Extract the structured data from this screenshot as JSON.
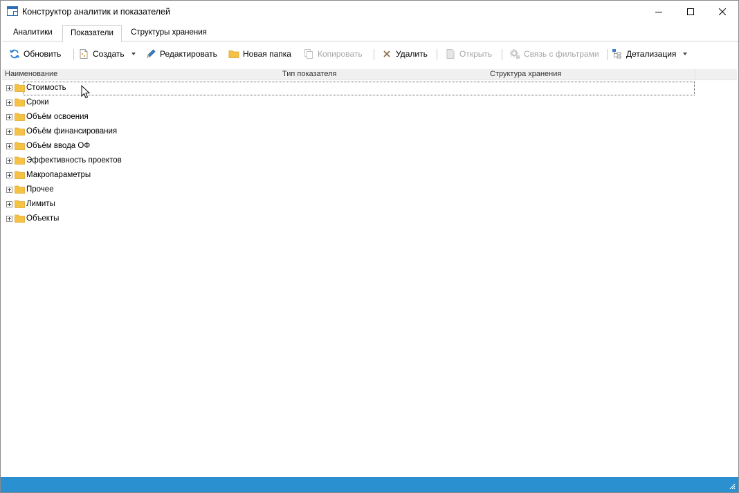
{
  "window": {
    "title": "Конструктор аналитик и показателей",
    "icons": {
      "app": "window-app-icon",
      "minimize": "minimize-icon",
      "maximize": "maximize-icon",
      "close": "close-icon"
    }
  },
  "tabs": [
    {
      "label": "Аналитики",
      "active": false
    },
    {
      "label": "Показатели",
      "active": true
    },
    {
      "label": "Структуры хранения",
      "active": false
    }
  ],
  "toolbar": {
    "refresh": {
      "label": "Обновить",
      "icon": "refresh-icon",
      "enabled": true
    },
    "create": {
      "label": "Создать",
      "icon": "new-document-icon",
      "enabled": true,
      "has_dropdown": true
    },
    "edit": {
      "label": "Редактировать",
      "icon": "pencil-icon",
      "enabled": true
    },
    "new_folder": {
      "label": "Новая папка",
      "icon": "folder-icon",
      "enabled": true
    },
    "copy": {
      "label": "Копировать",
      "icon": "copy-icon",
      "enabled": false
    },
    "delete": {
      "label": "Удалить",
      "icon": "delete-icon",
      "enabled": true
    },
    "open": {
      "label": "Открыть",
      "icon": "open-document-icon",
      "enabled": false
    },
    "filter_link": {
      "label": "Связь с фильтрами",
      "icon": "gear-link-icon",
      "enabled": false
    },
    "detail": {
      "label": "Детализация",
      "icon": "hierarchy-icon",
      "enabled": true,
      "has_dropdown": true
    }
  },
  "grid": {
    "columns": [
      "Наименование",
      "Тип показателя",
      "Структура хранения"
    ],
    "rows": [
      {
        "label": "Стоимость",
        "selected": true
      },
      {
        "label": "Сроки",
        "selected": false
      },
      {
        "label": "Объём освоения",
        "selected": false
      },
      {
        "label": "Объём финансирования",
        "selected": false
      },
      {
        "label": "Объём ввода ОФ",
        "selected": false
      },
      {
        "label": "Эффективность проектов",
        "selected": false
      },
      {
        "label": "Макропараметры",
        "selected": false
      },
      {
        "label": "Прочее",
        "selected": false
      },
      {
        "label": "Лимиты",
        "selected": false
      },
      {
        "label": "Объекты",
        "selected": false
      }
    ]
  },
  "colors": {
    "statusbar": "#2b90d0",
    "folder": "#f6c243",
    "accent": "#2d6db5",
    "disabled_text": "#a6a6a6"
  }
}
